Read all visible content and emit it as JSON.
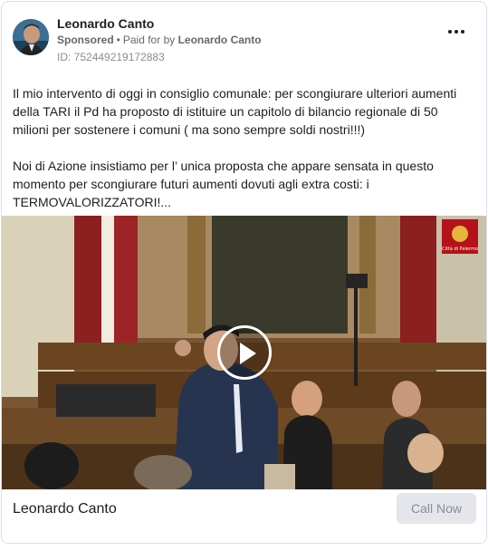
{
  "ad": {
    "advertiser_name": "Leonardo Canto",
    "sponsored_label": "Sponsored",
    "paid_for_prefix": "Paid for by",
    "paid_for_name": "Leonardo Canto",
    "ad_id": "ID: 752449219172883",
    "more_icon": "more-horizontal-icon"
  },
  "post": {
    "paragraph_1": "Il mio intervento di oggi in consiglio comunale: per scongiurare ulteriori aumenti della TARI il Pd ha proposto di istituire un capitolo di bilancio regionale di 50 milioni per sostenere i comuni ( ma sono sempre soldi nostri!!!)",
    "paragraph_2": "Noi di Azione insistiamo per l’ unica proposta che appare sensata in questo momento per scongiurare futuri aumenti dovuti agli extra costi: i TERMOVALORIZZATORI!..."
  },
  "media": {
    "type": "video",
    "play_icon": "play-icon",
    "logo_caption": "Città di Palermo"
  },
  "footer": {
    "page_name": "Leonardo Canto",
    "cta_label": "Call Now"
  },
  "colors": {
    "primary_text": "#1c1e21",
    "secondary_text": "#65676b",
    "cta_background": "#e4e6eb",
    "logo_red": "#b5121b"
  }
}
